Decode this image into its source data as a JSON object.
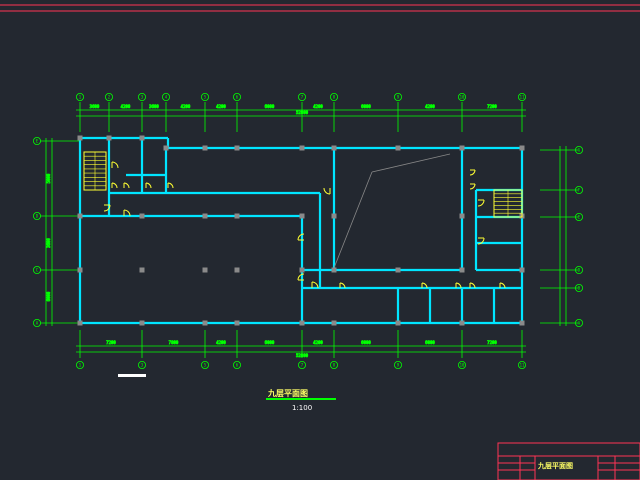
{
  "drawing": {
    "title": "九层平面图",
    "scale": "1:100",
    "title_block_name": "九层平面图"
  },
  "axes": {
    "horizontal_top": [
      "1",
      "2",
      "3",
      "4",
      "5",
      "6",
      "7",
      "8",
      "9",
      "10",
      "11"
    ],
    "horizontal_bottom": [
      "1",
      "3",
      "5",
      "6",
      "7",
      "8",
      "9",
      "10",
      "11"
    ],
    "vertical_left": [
      "E",
      "D",
      "C",
      "A"
    ],
    "vertical_right": [
      "G",
      "F",
      "E",
      "D",
      "B",
      "A"
    ]
  },
  "dimensions": {
    "top_segments": [
      "3600",
      "4200",
      "3600",
      "4200",
      "4200",
      "6000",
      "4200",
      "6000",
      "4200",
      "7200"
    ],
    "bottom_segments": [
      "7200",
      "7800",
      "4200",
      "6000",
      "4200",
      "6000",
      "6000",
      "7200"
    ],
    "overall": "52800"
  },
  "colors": {
    "background": "#232830",
    "wall": "#00e5ff",
    "dim": "#00ff00",
    "door": "#ffff33",
    "stair": "#ffff33",
    "column": "#8a8a8a",
    "frame": "#ff3355",
    "text": "#ffffff",
    "axis_bubble": "#00ff00"
  }
}
